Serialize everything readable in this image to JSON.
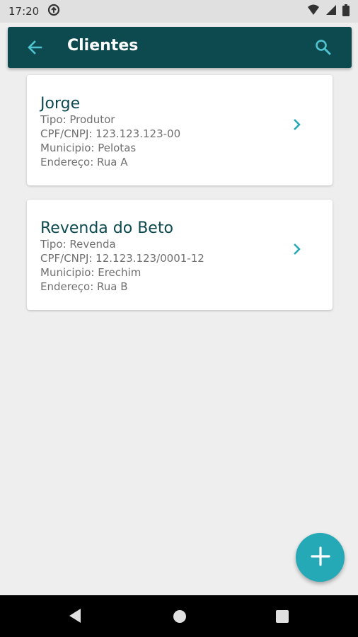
{
  "status_bar": {
    "time": "17:20"
  },
  "app_bar": {
    "title": "Clientes",
    "back_icon": "arrow-left-icon",
    "search_icon": "search-icon"
  },
  "clients": [
    {
      "name": "Jorge",
      "tipo": "Tipo: Produtor",
      "cpf": "CPF/CNPJ: 123.123.123-00",
      "municipio": "Municipio: Pelotas",
      "endereco": "Endereço: Rua A"
    },
    {
      "name": "Revenda do Beto",
      "tipo": "Tipo: Revenda",
      "cpf": "CPF/CNPJ: 12.123.123/0001-12",
      "municipio": "Municipio: Erechim",
      "endereco": "Endereço: Rua B"
    }
  ],
  "fab": {
    "icon": "plus-icon"
  },
  "colors": {
    "primary": "#0c4a50",
    "accent": "#26a9b6",
    "background": "#eeeeee"
  }
}
